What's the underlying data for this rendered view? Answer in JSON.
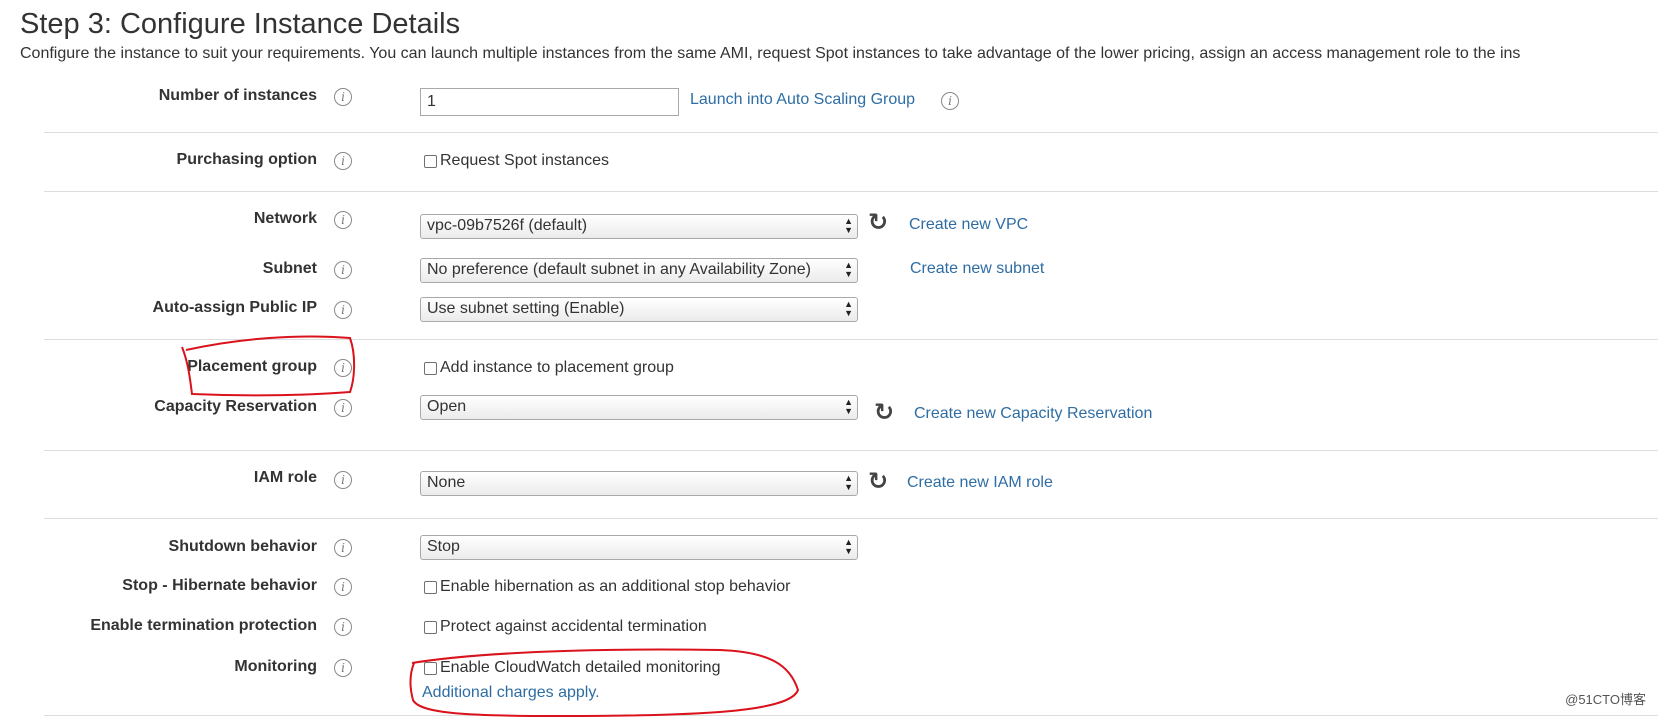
{
  "header": {
    "title": "Step 3: Configure Instance Details",
    "description": "Configure the instance to suit your requirements. You can launch multiple instances from the same AMI, request Spot instances to take advantage of the lower pricing, assign an access management role to the ins"
  },
  "fields": {
    "num_instances": {
      "label": "Number of instances",
      "value": "1",
      "link": "Launch into Auto Scaling Group"
    },
    "purchasing": {
      "label": "Purchasing option",
      "checkbox": "Request Spot instances"
    },
    "network": {
      "label": "Network",
      "value": "vpc-09b7526f (default)",
      "link": "Create new VPC"
    },
    "subnet": {
      "label": "Subnet",
      "value": "No preference (default subnet in any Availability Zone)",
      "link": "Create new subnet"
    },
    "public_ip": {
      "label": "Auto-assign Public IP",
      "value": "Use subnet setting (Enable)"
    },
    "placement": {
      "label": "Placement group",
      "checkbox": "Add instance to placement group"
    },
    "capacity": {
      "label": "Capacity Reservation",
      "value": "Open",
      "link": "Create new Capacity Reservation"
    },
    "iam": {
      "label": "IAM role",
      "value": "None",
      "link": "Create new IAM role"
    },
    "shutdown": {
      "label": "Shutdown behavior",
      "value": "Stop"
    },
    "hibernate": {
      "label": "Stop - Hibernate behavior",
      "checkbox": "Enable hibernation as an additional stop behavior"
    },
    "termination": {
      "label": "Enable termination protection",
      "checkbox": "Protect against accidental termination"
    },
    "monitoring": {
      "label": "Monitoring",
      "checkbox": "Enable CloudWatch detailed monitoring",
      "link": "Additional charges apply."
    }
  },
  "icons": {
    "info": "i",
    "refresh": "↻"
  },
  "watermark": "@51CTO博客",
  "colors": {
    "link": "#2e6da4",
    "annotation": "#d9121b"
  }
}
